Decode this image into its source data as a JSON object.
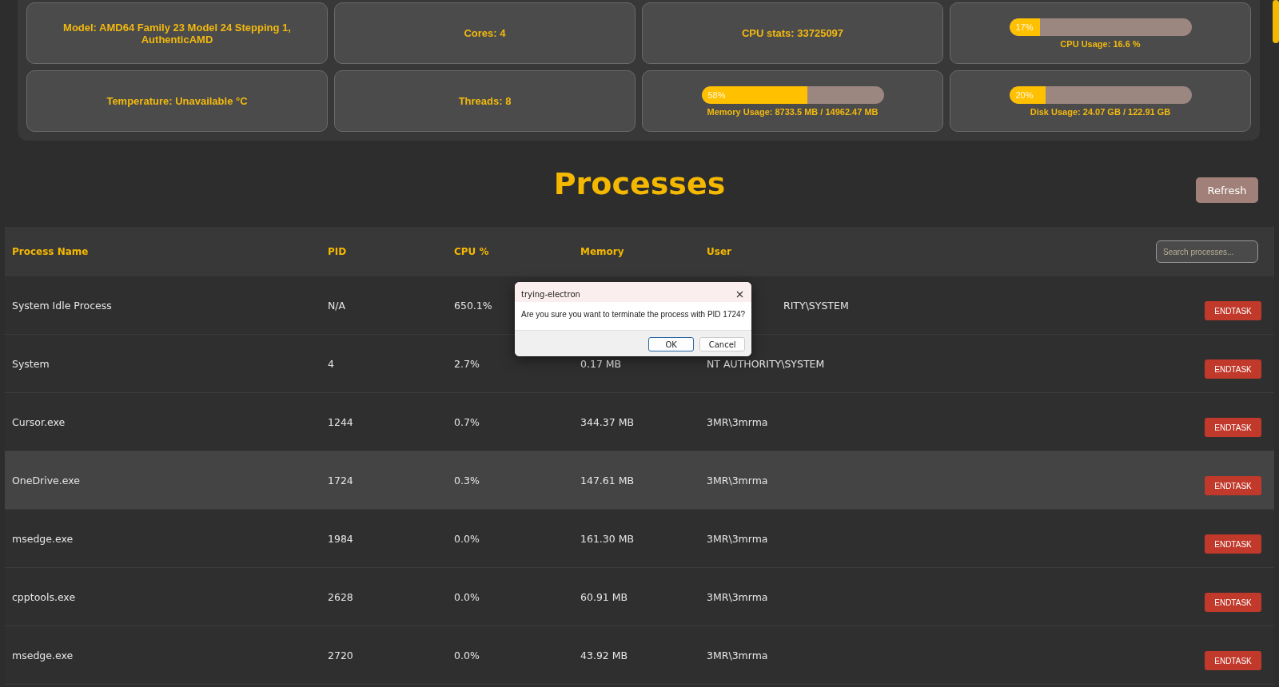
{
  "stats": [
    {
      "kind": "text",
      "label": "Model: AMD64 Family 23 Model 24 Stepping 1, AuthenticAMD"
    },
    {
      "kind": "text",
      "label": "Cores: 4"
    },
    {
      "kind": "text",
      "label": "CPU stats: 33725097"
    },
    {
      "kind": "meter",
      "level": 0.17,
      "reading": "17%",
      "label": "CPU Usage: 16.6 %"
    },
    {
      "kind": "text",
      "label": "Temperature: Unavailable °C"
    },
    {
      "kind": "text",
      "label": "Threads: 8"
    },
    {
      "kind": "meter",
      "level": 0.58,
      "reading": "58%",
      "label": "Memory Usage: 8733.5 MB / 14962.47 MB"
    },
    {
      "kind": "meter",
      "level": 0.2,
      "reading": "20%",
      "label": "Disk Usage: 24.07 GB / 122.91 GB"
    }
  ],
  "title": "Processes",
  "refresh_button": "Refresh",
  "table": {
    "columns": [
      "Process Name",
      "PID",
      "CPU %",
      "Memory",
      "User"
    ],
    "search": {
      "placeholder": "Search processes..."
    },
    "rows": [
      {
        "name": "System Idle Process",
        "pid": "N/A",
        "cpu": "650.1%",
        "user": "RITY\\SYSTEM",
        "action": "ENDTASK",
        "selected": false
      },
      {
        "name": "System",
        "pid": "4",
        "cpu": "2.7%",
        "memory": "0.17 MB",
        "user": "NT AUTHORITY\\SYSTEM",
        "action": "ENDTASK",
        "selected": false
      },
      {
        "name": "Cursor.exe",
        "pid": "1244",
        "cpu": "0.7%",
        "memory": "344.37 MB",
        "user": "3MR\\3mrma",
        "action": "ENDTASK",
        "selected": false
      },
      {
        "name": "OneDrive.exe",
        "pid": "1724",
        "cpu": "0.3%",
        "memory": "147.61 MB",
        "user": "3MR\\3mrma",
        "action": "ENDTASK",
        "selected": true
      },
      {
        "name": "msedge.exe",
        "pid": "1984",
        "cpu": "0.0%",
        "memory": "161.30 MB",
        "user": "3MR\\3mrma",
        "action": "ENDTASK",
        "selected": false
      },
      {
        "name": "cpptools.exe",
        "pid": "2628",
        "cpu": "0.0%",
        "memory": "60.91 MB",
        "user": "3MR\\3mrma",
        "action": "ENDTASK",
        "selected": false
      },
      {
        "name": "msedge.exe",
        "pid": "2720",
        "cpu": "0.0%",
        "memory": "43.92 MB",
        "user": "3MR\\3mrma",
        "action": "ENDTASK",
        "selected": false
      }
    ]
  },
  "dialog": {
    "title": "trying-electron",
    "message": "Are you sure you want to terminate the process with PID 1724?",
    "buttons": [
      "OK",
      "Cancel"
    ]
  }
}
